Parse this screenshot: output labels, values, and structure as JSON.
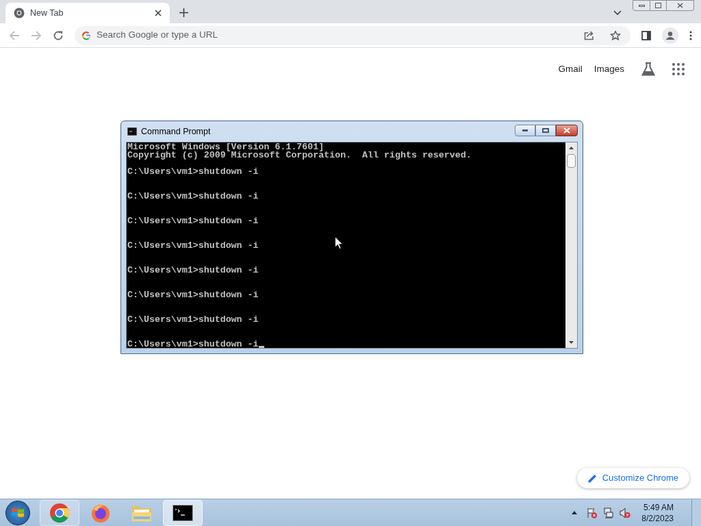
{
  "browser": {
    "tab": {
      "title": "New Tab",
      "selected": true
    },
    "omnibox": {
      "placeholder": "Search Google or type a URL"
    }
  },
  "page": {
    "links": [
      "Gmail",
      "Images"
    ],
    "customize_button": "Customize Chrome"
  },
  "console_window": {
    "title": "Command Prompt",
    "cursor": true,
    "lines": [
      {
        "kind": "banner",
        "text": "Microsoft Windows [Version 6.1.7601]"
      },
      {
        "kind": "banner",
        "text": "Copyright (c) 2009 Microsoft Corporation.  All rights reserved."
      },
      {
        "kind": "command",
        "text": "C:\\Users\\vm1>shutdown -i"
      },
      {
        "kind": "command",
        "text": "C:\\Users\\vm1>shutdown -i"
      },
      {
        "kind": "command",
        "text": "C:\\Users\\vm1>shutdown -i"
      },
      {
        "kind": "command",
        "text": "C:\\Users\\vm1>shutdown -i"
      },
      {
        "kind": "command",
        "text": "C:\\Users\\vm1>shutdown -i"
      },
      {
        "kind": "command",
        "text": "C:\\Users\\vm1>shutdown -i"
      },
      {
        "kind": "command",
        "text": "C:\\Users\\vm1>shutdown -i"
      },
      {
        "kind": "command",
        "text": "C:\\Users\\vm1>shutdown -i"
      }
    ]
  },
  "taskbar": {
    "apps": [
      {
        "kind": "chrome",
        "selected": false
      },
      {
        "kind": "firefox",
        "selected": false
      },
      {
        "kind": "folder",
        "selected": false
      },
      {
        "kind": "console",
        "selected": true
      }
    ],
    "clock": {
      "time": "5:49 AM",
      "date": "8/2/2023"
    }
  }
}
